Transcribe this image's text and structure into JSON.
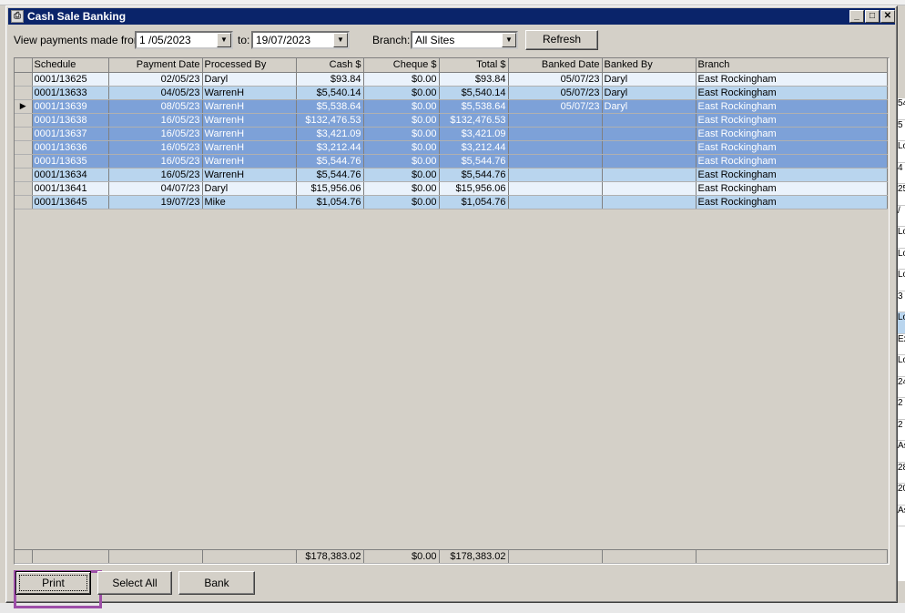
{
  "window": {
    "title": "Cash Sale Banking",
    "app_icon": "printer-icon"
  },
  "filters": {
    "from_label": "View payments made from:",
    "from_value": "1 /05/2023",
    "to_label": "to:",
    "to_value": "19/07/2023",
    "branch_label": "Branch:",
    "branch_value": "All Sites",
    "refresh_label": "Refresh"
  },
  "grid": {
    "columns": [
      "Schedule",
      "Payment Date",
      "Processed By",
      "Cash $",
      "Cheque $",
      "Total $",
      "Banked Date",
      "Banked By",
      "Branch"
    ],
    "rows": [
      {
        "schedule": "0001/13625",
        "payment_date": "02/05/23",
        "processed_by": "Daryl",
        "cash": "$93.84",
        "cheque": "$0.00",
        "total": "$93.84",
        "banked_date": "05/07/23",
        "banked_by": "Daryl",
        "branch": "East Rockingham",
        "style": "light"
      },
      {
        "schedule": "0001/13633",
        "payment_date": "04/05/23",
        "processed_by": "WarrenH",
        "cash": "$5,540.14",
        "cheque": "$0.00",
        "total": "$5,540.14",
        "banked_date": "05/07/23",
        "banked_by": "Daryl",
        "branch": "East Rockingham",
        "style": "blue"
      },
      {
        "schedule": "0001/13639",
        "payment_date": "08/05/23",
        "processed_by": "WarrenH",
        "cash": "$5,538.64",
        "cheque": "$0.00",
        "total": "$5,538.64",
        "banked_date": "05/07/23",
        "banked_by": "Daryl",
        "branch": "East Rockingham",
        "style": "sel",
        "current": true
      },
      {
        "schedule": "0001/13638",
        "payment_date": "16/05/23",
        "processed_by": "WarrenH",
        "cash": "$132,476.53",
        "cheque": "$0.00",
        "total": "$132,476.53",
        "banked_date": "",
        "banked_by": "",
        "branch": "East Rockingham",
        "style": "sel"
      },
      {
        "schedule": "0001/13637",
        "payment_date": "16/05/23",
        "processed_by": "WarrenH",
        "cash": "$3,421.09",
        "cheque": "$0.00",
        "total": "$3,421.09",
        "banked_date": "",
        "banked_by": "",
        "branch": "East Rockingham",
        "style": "sel"
      },
      {
        "schedule": "0001/13636",
        "payment_date": "16/05/23",
        "processed_by": "WarrenH",
        "cash": "$3,212.44",
        "cheque": "$0.00",
        "total": "$3,212.44",
        "banked_date": "",
        "banked_by": "",
        "branch": "East Rockingham",
        "style": "sel"
      },
      {
        "schedule": "0001/13635",
        "payment_date": "16/05/23",
        "processed_by": "WarrenH",
        "cash": "$5,544.76",
        "cheque": "$0.00",
        "total": "$5,544.76",
        "banked_date": "",
        "banked_by": "",
        "branch": "East Rockingham",
        "style": "sel"
      },
      {
        "schedule": "0001/13634",
        "payment_date": "16/05/23",
        "processed_by": "WarrenH",
        "cash": "$5,544.76",
        "cheque": "$0.00",
        "total": "$5,544.76",
        "banked_date": "",
        "banked_by": "",
        "branch": "East Rockingham",
        "style": "blue"
      },
      {
        "schedule": "0001/13641",
        "payment_date": "04/07/23",
        "processed_by": "Daryl",
        "cash": "$15,956.06",
        "cheque": "$0.00",
        "total": "$15,956.06",
        "banked_date": "",
        "banked_by": "",
        "branch": "East Rockingham",
        "style": "light"
      },
      {
        "schedule": "0001/13645",
        "payment_date": "19/07/23",
        "processed_by": "Mike",
        "cash": "$1,054.76",
        "cheque": "$0.00",
        "total": "$1,054.76",
        "banked_date": "",
        "banked_by": "",
        "branch": "East Rockingham",
        "style": "blue"
      }
    ],
    "totals": {
      "cash": "$178,383.02",
      "cheque": "$0.00",
      "total": "$178,383.02"
    }
  },
  "buttons": {
    "print": "Print",
    "select_all": "Select All",
    "bank": "Bank"
  },
  "background_strip": [
    "54",
    "5",
    "Lo",
    "4",
    "25",
    "/",
    "Lo",
    "Lo",
    "Lo",
    "3 I",
    "Lo",
    "Ex",
    "Lo",
    "24",
    "2",
    "2",
    "As",
    "28",
    "20",
    "As"
  ]
}
